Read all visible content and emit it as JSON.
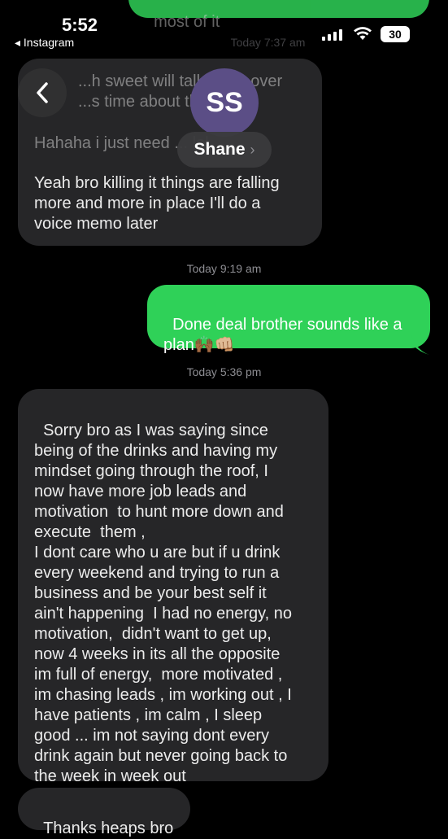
{
  "status_bar": {
    "time": "5:52",
    "back_app": "◂ Instagram",
    "battery": "30"
  },
  "header": {
    "avatar_initials": "SS",
    "contact_name": "Shane",
    "chevron": "›"
  },
  "top_partial_text": "most of it",
  "timestamps": {
    "t1": "Today 7:37 am",
    "t2": "Today 9:19 am",
    "t3": "Today 5:36 pm"
  },
  "messages": [
    {
      "text": "...h sweet will talk more over\n...s time about the ...ep",
      "direction": "in"
    },
    {
      "text": "Hahaha i just need ... lol",
      "direction": "in"
    },
    {
      "text": "Yeah bro killing it things are falling\nmore and more in place I'll do a\nvoice memo later",
      "direction": "in"
    },
    {
      "text": "Done deal brother sounds like a\nplan🙌🏾👊🏼",
      "direction": "out"
    },
    {
      "text": "Sorry bro as I was saying since\nbeing of the drinks and having my\nmindset going through the roof, I\nnow have more job leads and\nmotivation  to hunt more down and\nexecute  them ,\nI dont care who u are but if u drink\nevery weekend and trying to run a\nbusiness and be your best self it\nain't happening  I had no energy, no\nmotivation,  didn't want to get up,\nnow 4 weeks in its all the opposite\nim full of energy,  more motivated ,\nim chasing leads , im working out , I\nhave patients , im calm , I sleep\ngood ... im not saying dont every\ndrink again but never going back to\nthe week in week out",
      "direction": "in"
    },
    {
      "text": "Thanks heaps bro",
      "direction": "in"
    }
  ],
  "colors": {
    "background": "#000000",
    "incoming_bubble": "#262628",
    "outgoing_bubble": "#2fd158",
    "avatar": "#5b4e86"
  }
}
